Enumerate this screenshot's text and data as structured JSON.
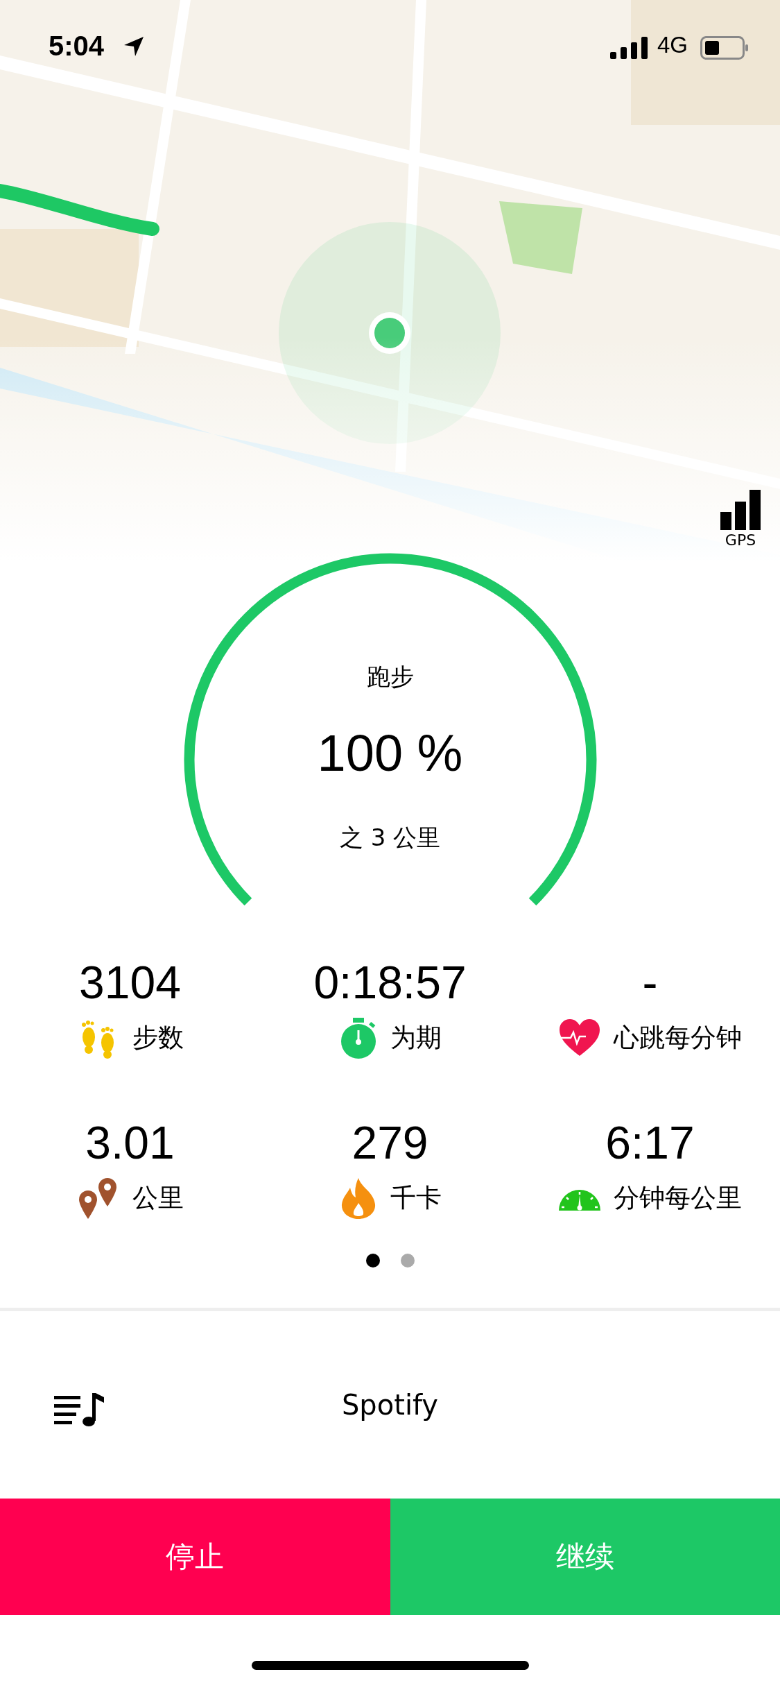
{
  "status_bar": {
    "time": "5:04",
    "network": "4G"
  },
  "map": {
    "gps_label": "GPS"
  },
  "goal": {
    "activity": "跑步",
    "percent": "100 %",
    "target": "之 3 公里"
  },
  "stats": [
    {
      "kind": "steps",
      "value": "3104",
      "label": "步数"
    },
    {
      "kind": "duration",
      "value": "0:18:57",
      "label": "为期"
    },
    {
      "kind": "heart",
      "value": "-",
      "label": "心跳每分钟"
    },
    {
      "kind": "distance",
      "value": "3.01",
      "label": "公里"
    },
    {
      "kind": "calories",
      "value": "279",
      "label": "千卡"
    },
    {
      "kind": "pace",
      "value": "6:17",
      "label": "分钟每公里"
    }
  ],
  "pages": [
    {
      "selected": true
    },
    {
      "selected": false
    }
  ],
  "music": {
    "label": "Spotify"
  },
  "buttons": [
    {
      "kind": "stop",
      "label": "停止"
    },
    {
      "kind": "resume",
      "label": "继续"
    }
  ]
}
